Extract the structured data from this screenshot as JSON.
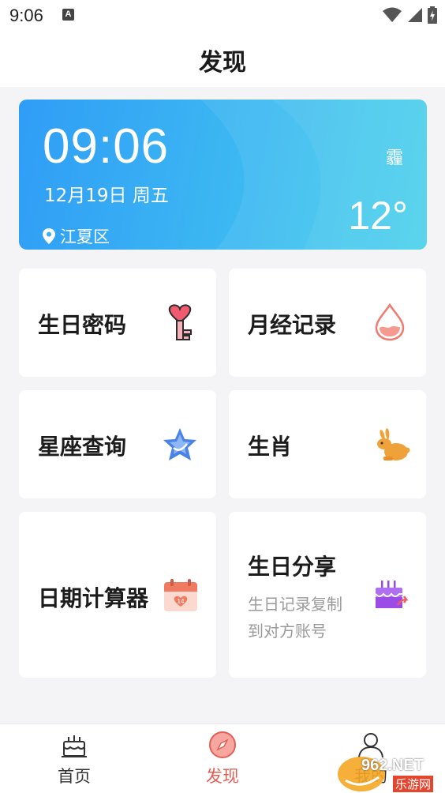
{
  "status_bar": {
    "time": "9:06",
    "notification_icon": "a-icon",
    "icons": [
      "wifi-icon",
      "signal-icon",
      "battery-charging-icon"
    ]
  },
  "header": {
    "title": "发现"
  },
  "weather": {
    "time": "09:06",
    "date": "12月19日  周五",
    "condition": "霾",
    "temperature": "12°",
    "location": "江夏区"
  },
  "cards": {
    "birthday_password": {
      "label": "生日密码",
      "icon": "heart-key-icon"
    },
    "period_record": {
      "label": "月经记录",
      "icon": "blood-drop-icon"
    },
    "constellation": {
      "label": "星座查询",
      "icon": "star-icon"
    },
    "zodiac": {
      "label": "生肖",
      "icon": "rabbit-icon"
    },
    "date_calculator": {
      "label": "日期计算器",
      "icon": "calendar-icon",
      "calendar_day": "14"
    },
    "birthday_share": {
      "label": "生日分享",
      "desc_line1": "生日记录复制",
      "desc_line2": "到对方账号",
      "icon": "cake-share-icon"
    }
  },
  "tabbar": {
    "tabs": [
      {
        "label": "首页",
        "icon": "cake-icon",
        "active": false
      },
      {
        "label": "发现",
        "icon": "compass-icon",
        "active": true
      },
      {
        "label": "我的",
        "icon": "person-icon",
        "active": false
      }
    ]
  },
  "watermark": {
    "text": "962.NET",
    "sub": "乐游网"
  },
  "colors": {
    "accent": "#e45e54",
    "weather_start": "#2f9df6",
    "weather_end": "#43d0ea",
    "background": "#f4f4f6"
  }
}
